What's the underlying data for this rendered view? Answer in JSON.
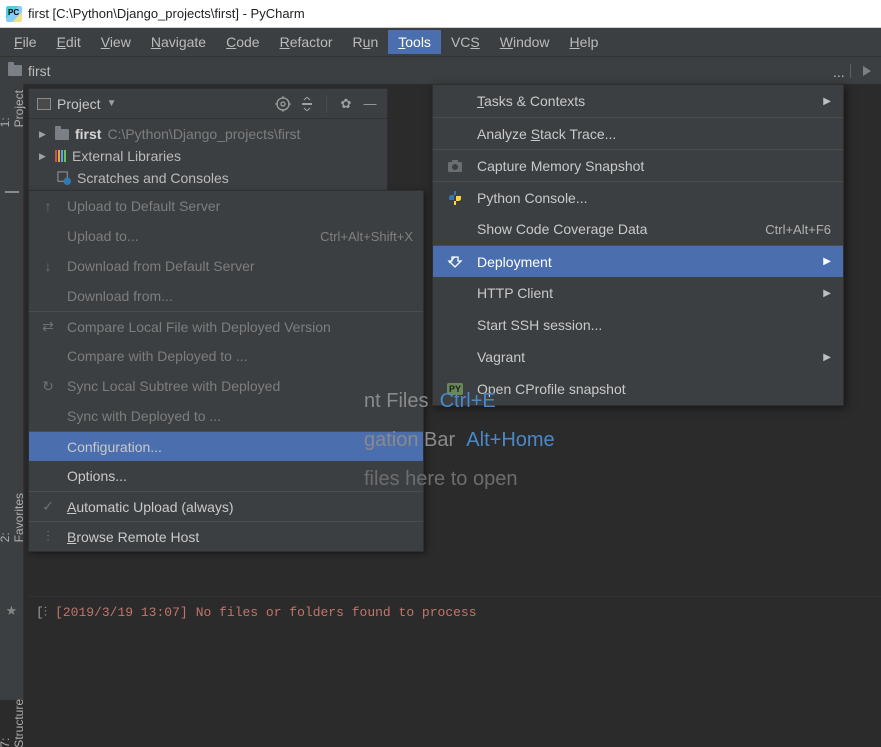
{
  "title": "first [C:\\Python\\Django_projects\\first] - PyCharm",
  "menubar": [
    "File",
    "Edit",
    "View",
    "Navigate",
    "Code",
    "Refactor",
    "Run",
    "Tools",
    "VCS",
    "Window",
    "Help"
  ],
  "menubar_active_index": 7,
  "breadcrumb": {
    "root": "first"
  },
  "leftrail": {
    "project": "1: Project",
    "favorites": "2: Favorites",
    "structure": "7: Structure"
  },
  "panel": {
    "title": "Project",
    "items": [
      {
        "name": "first",
        "path": "C:\\Python\\Django_projects\\first"
      },
      {
        "name": "External Libraries"
      },
      {
        "name": "Scratches and Consoles"
      }
    ]
  },
  "deployment_submenu": [
    {
      "label": "Upload to Default Server",
      "icon": "upload",
      "disabled": true
    },
    {
      "label": "Upload to...",
      "shortcut": "Ctrl+Alt+Shift+X",
      "disabled": true
    },
    {
      "label": "Download from Default Server",
      "icon": "download",
      "disabled": true
    },
    {
      "label": "Download from...",
      "disabled": true
    },
    {
      "label": "Compare Local File with Deployed Version",
      "icon": "compare",
      "sep": true,
      "disabled": true
    },
    {
      "label": "Compare with Deployed to ...",
      "disabled": true
    },
    {
      "label": "Sync Local Subtree with Deployed",
      "icon": "sync",
      "disabled": true
    },
    {
      "label": "Sync with Deployed to ...",
      "disabled": true
    },
    {
      "label": "Configuration...",
      "sep": true,
      "highlight": true
    },
    {
      "label": "Options..."
    },
    {
      "label": "Automatic Upload (always)",
      "icon": "check",
      "sep": true
    },
    {
      "label": "Browse Remote Host",
      "icon": "browse",
      "sep": true
    }
  ],
  "tools_menu": [
    {
      "label": "Tasks & Contexts",
      "submenu": true
    },
    {
      "label": "Analyze Stack Trace...",
      "sep": true
    },
    {
      "label": "Capture Memory Snapshot",
      "icon": "snapshot",
      "sep": true
    },
    {
      "label": "Python Console...",
      "icon": "python",
      "sep": true
    },
    {
      "label": "Show Code Coverage Data",
      "shortcut": "Ctrl+Alt+F6"
    },
    {
      "label": "Deployment",
      "icon": "deploy",
      "submenu": true,
      "sep": true,
      "highlight": true
    },
    {
      "label": "HTTP Client",
      "submenu": true
    },
    {
      "label": "Start SSH session..."
    },
    {
      "label": "Vagrant",
      "submenu": true
    },
    {
      "label": "Open CProfile snapshot",
      "icon": "py"
    }
  ],
  "editor_ghost": {
    "l1a": "nt Files",
    "l1b": "Ctrl+E",
    "l2a": "gation Bar",
    "l2b": "Alt+Home",
    "l3": "files here to open"
  },
  "console": {
    "timestamp": "[2019/3/19 13:07]",
    "message": "No files or folders found to process"
  }
}
